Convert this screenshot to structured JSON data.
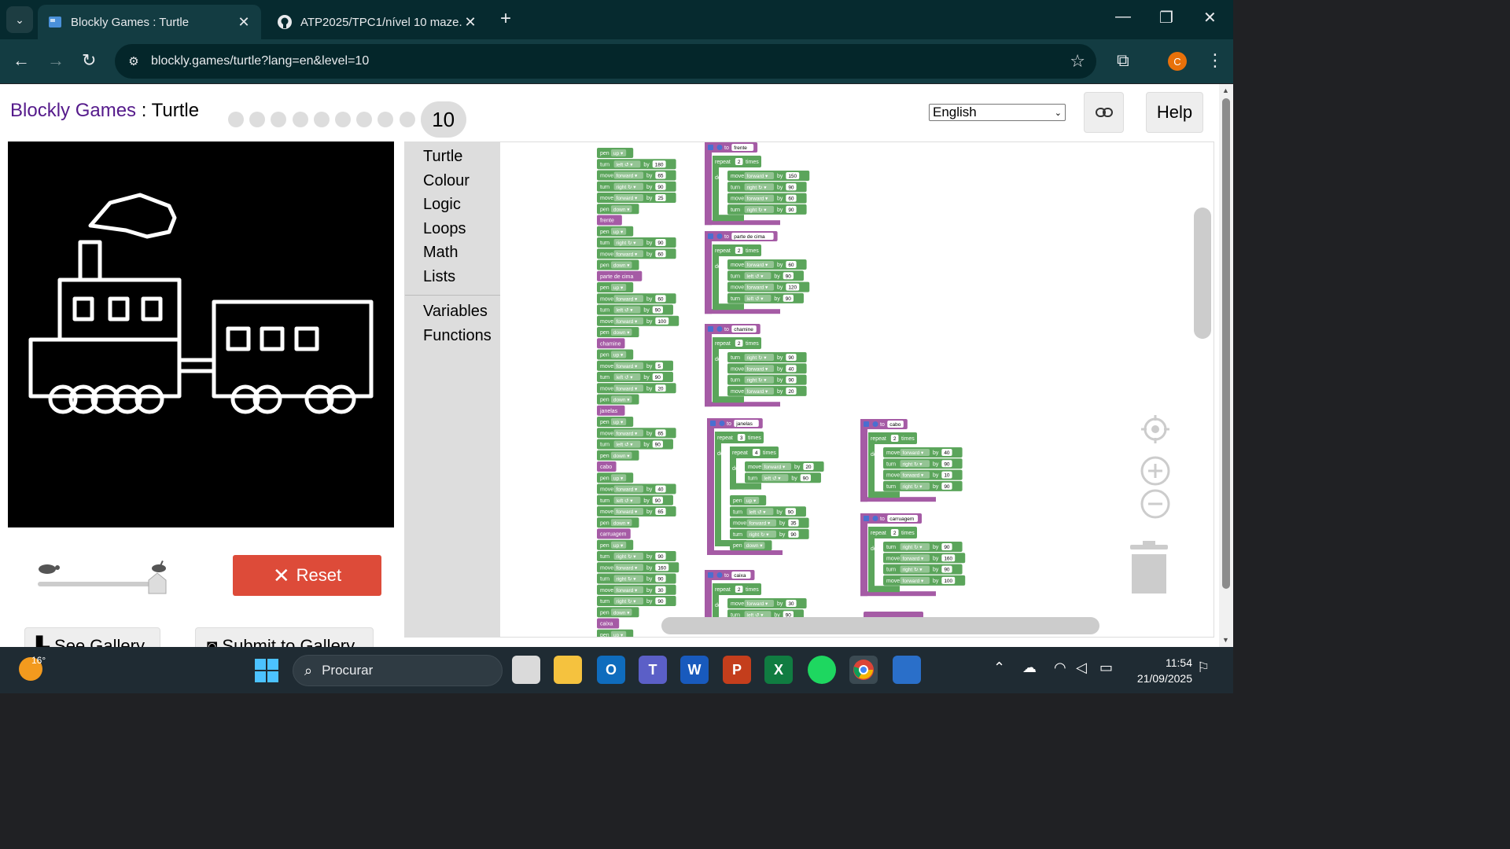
{
  "browser": {
    "tabs": [
      {
        "title": "Blockly Games : Turtle",
        "active": true
      },
      {
        "title": "ATP2025/TPC1/nível 10 maze.pr",
        "active": false
      }
    ],
    "url": "blockly.games/turtle?lang=en&level=10",
    "profile_initial": "C",
    "accent": "#e8710a"
  },
  "page": {
    "brand": "Blockly Games",
    "separator": " : ",
    "game": "Turtle",
    "level": "10",
    "language": "English",
    "help": "Help",
    "reset": "Reset",
    "see_gallery": "See Gallery",
    "submit_gallery": "Submit to Gallery",
    "reset_color": "#dd4b39"
  },
  "toolbox": {
    "categories": [
      "Turtle",
      "Colour",
      "Logic",
      "Loops",
      "Math",
      "Lists"
    ],
    "categories2": [
      "Variables",
      "Functions"
    ]
  },
  "blocks": {
    "main_script": [
      {
        "kind": "cmd",
        "text": "pen",
        "dd": "up"
      },
      {
        "kind": "cmd",
        "text": "turn",
        "dd": "left ↺",
        "num": "180"
      },
      {
        "kind": "cmd",
        "text": "move",
        "dd": "forward",
        "num": "65"
      },
      {
        "kind": "cmd",
        "text": "turn",
        "dd": "right ↻",
        "num": "90"
      },
      {
        "kind": "cmd",
        "text": "move",
        "dd": "forward",
        "num": "25"
      },
      {
        "kind": "cmd",
        "text": "pen",
        "dd": "down"
      },
      {
        "kind": "call",
        "text": "frente"
      },
      {
        "kind": "cmd",
        "text": "pen",
        "dd": "up"
      },
      {
        "kind": "cmd",
        "text": "turn",
        "dd": "right ↻",
        "num": "90"
      },
      {
        "kind": "cmd",
        "text": "move",
        "dd": "forward",
        "num": "60"
      },
      {
        "kind": "cmd",
        "text": "pen",
        "dd": "down"
      },
      {
        "kind": "call",
        "text": "parte de cima"
      },
      {
        "kind": "cmd",
        "text": "pen",
        "dd": "up"
      },
      {
        "kind": "cmd",
        "text": "move",
        "dd": "forward",
        "num": "60"
      },
      {
        "kind": "cmd",
        "text": "turn",
        "dd": "left ↺",
        "num": "90"
      },
      {
        "kind": "cmd",
        "text": "move",
        "dd": "forward",
        "num": "100"
      },
      {
        "kind": "cmd",
        "text": "pen",
        "dd": "down"
      },
      {
        "kind": "call",
        "text": "chamine"
      },
      {
        "kind": "cmd",
        "text": "pen",
        "dd": "up"
      },
      {
        "kind": "cmd",
        "text": "move",
        "dd": "forward",
        "num": "5"
      },
      {
        "kind": "cmd",
        "text": "turn",
        "dd": "left ↺",
        "num": "90"
      },
      {
        "kind": "cmd",
        "text": "move",
        "dd": "forward",
        "num": "20"
      },
      {
        "kind": "cmd",
        "text": "pen",
        "dd": "down"
      },
      {
        "kind": "call",
        "text": "janelas"
      },
      {
        "kind": "cmd",
        "text": "pen",
        "dd": "up"
      },
      {
        "kind": "cmd",
        "text": "move",
        "dd": "forward",
        "num": "65"
      },
      {
        "kind": "cmd",
        "text": "turn",
        "dd": "left ↺",
        "num": "90"
      },
      {
        "kind": "cmd",
        "text": "pen",
        "dd": "down"
      },
      {
        "kind": "call",
        "text": "cabo"
      },
      {
        "kind": "cmd",
        "text": "pen",
        "dd": "up"
      },
      {
        "kind": "cmd",
        "text": "move",
        "dd": "forward",
        "num": "40"
      },
      {
        "kind": "cmd",
        "text": "turn",
        "dd": "left ↺",
        "num": "90"
      },
      {
        "kind": "cmd",
        "text": "move",
        "dd": "forward",
        "num": "65"
      },
      {
        "kind": "cmd",
        "text": "pen",
        "dd": "down"
      },
      {
        "kind": "call",
        "text": "carruagem"
      },
      {
        "kind": "cmd",
        "text": "pen",
        "dd": "up"
      },
      {
        "kind": "cmd",
        "text": "turn",
        "dd": "right ↻",
        "num": "90"
      },
      {
        "kind": "cmd",
        "text": "move",
        "dd": "forward",
        "num": "160"
      },
      {
        "kind": "cmd",
        "text": "turn",
        "dd": "right ↻",
        "num": "90"
      },
      {
        "kind": "cmd",
        "text": "move",
        "dd": "forward",
        "num": "30"
      },
      {
        "kind": "cmd",
        "text": "turn",
        "dd": "right ↻",
        "num": "90"
      },
      {
        "kind": "cmd",
        "text": "pen",
        "dd": "down"
      },
      {
        "kind": "call",
        "text": "caixa"
      },
      {
        "kind": "cmd",
        "text": "pen",
        "dd": "up"
      }
    ],
    "functions": [
      {
        "name": "frente",
        "repeat": "2",
        "body": [
          {
            "text": "move",
            "dd": "forward",
            "num": "150"
          },
          {
            "text": "turn",
            "dd": "right ↻",
            "num": "90"
          },
          {
            "text": "move",
            "dd": "forward",
            "num": "60"
          },
          {
            "text": "turn",
            "dd": "right ↻",
            "num": "90"
          }
        ]
      },
      {
        "name": "parte de cima",
        "repeat": "2",
        "body": [
          {
            "text": "move",
            "dd": "forward",
            "num": "60"
          },
          {
            "text": "turn",
            "dd": "left ↺",
            "num": "90"
          },
          {
            "text": "move",
            "dd": "forward",
            "num": "120"
          },
          {
            "text": "turn",
            "dd": "left ↺",
            "num": "90"
          }
        ]
      },
      {
        "name": "chamine",
        "repeat": "2",
        "body": [
          {
            "text": "turn",
            "dd": "right ↻",
            "num": "90"
          },
          {
            "text": "move",
            "dd": "forward",
            "num": "40"
          },
          {
            "text": "turn",
            "dd": "right ↻",
            "num": "90"
          },
          {
            "text": "move",
            "dd": "forward",
            "num": "20"
          }
        ]
      },
      {
        "name": "cabo",
        "repeat": "2",
        "body": [
          {
            "text": "move",
            "dd": "forward",
            "num": "40"
          },
          {
            "text": "turn",
            "dd": "right ↻",
            "num": "90"
          },
          {
            "text": "move",
            "dd": "forward",
            "num": "10"
          },
          {
            "text": "turn",
            "dd": "right ↻",
            "num": "90"
          }
        ]
      },
      {
        "name": "carruagem",
        "repeat": "2",
        "body": [
          {
            "text": "turn",
            "dd": "right ↻",
            "num": "90"
          },
          {
            "text": "move",
            "dd": "forward",
            "num": "160"
          },
          {
            "text": "turn",
            "dd": "right ↻",
            "num": "90"
          },
          {
            "text": "move",
            "dd": "forward",
            "num": "100"
          }
        ]
      },
      {
        "name": "caixa",
        "repeat": "2",
        "body": [
          {
            "text": "move",
            "dd": "forward",
            "num": "30"
          },
          {
            "text": "turn",
            "dd": "left ↺",
            "num": "90"
          }
        ]
      }
    ],
    "janelas": {
      "name": "janelas",
      "outer_repeat": "3",
      "inner_repeat": "4",
      "inner_body": [
        {
          "text": "move",
          "dd": "forward",
          "num": "20"
        },
        {
          "text": "turn",
          "dd": "left ↺",
          "num": "90"
        }
      ],
      "after_inner": [
        {
          "text": "pen",
          "dd": "up"
        },
        {
          "text": "turn",
          "dd": "left ↺",
          "num": "90"
        },
        {
          "text": "move",
          "dd": "forward",
          "num": "35"
        },
        {
          "text": "turn",
          "dd": "right ↻",
          "num": "90"
        },
        {
          "text": "pen",
          "dd": "down"
        }
      ]
    },
    "labels": {
      "to": "to",
      "repeat": "repeat",
      "times": "times",
      "do": "do",
      "by": "by"
    },
    "colors": {
      "turtle": "#5ba55b",
      "func": "#a55ba5",
      "loop": "#5ba55b",
      "field": "#ffffff"
    }
  },
  "taskbar": {
    "temperature": "16°",
    "search_placeholder": "Procurar",
    "time": "11:54",
    "date": "21/09/2025"
  }
}
